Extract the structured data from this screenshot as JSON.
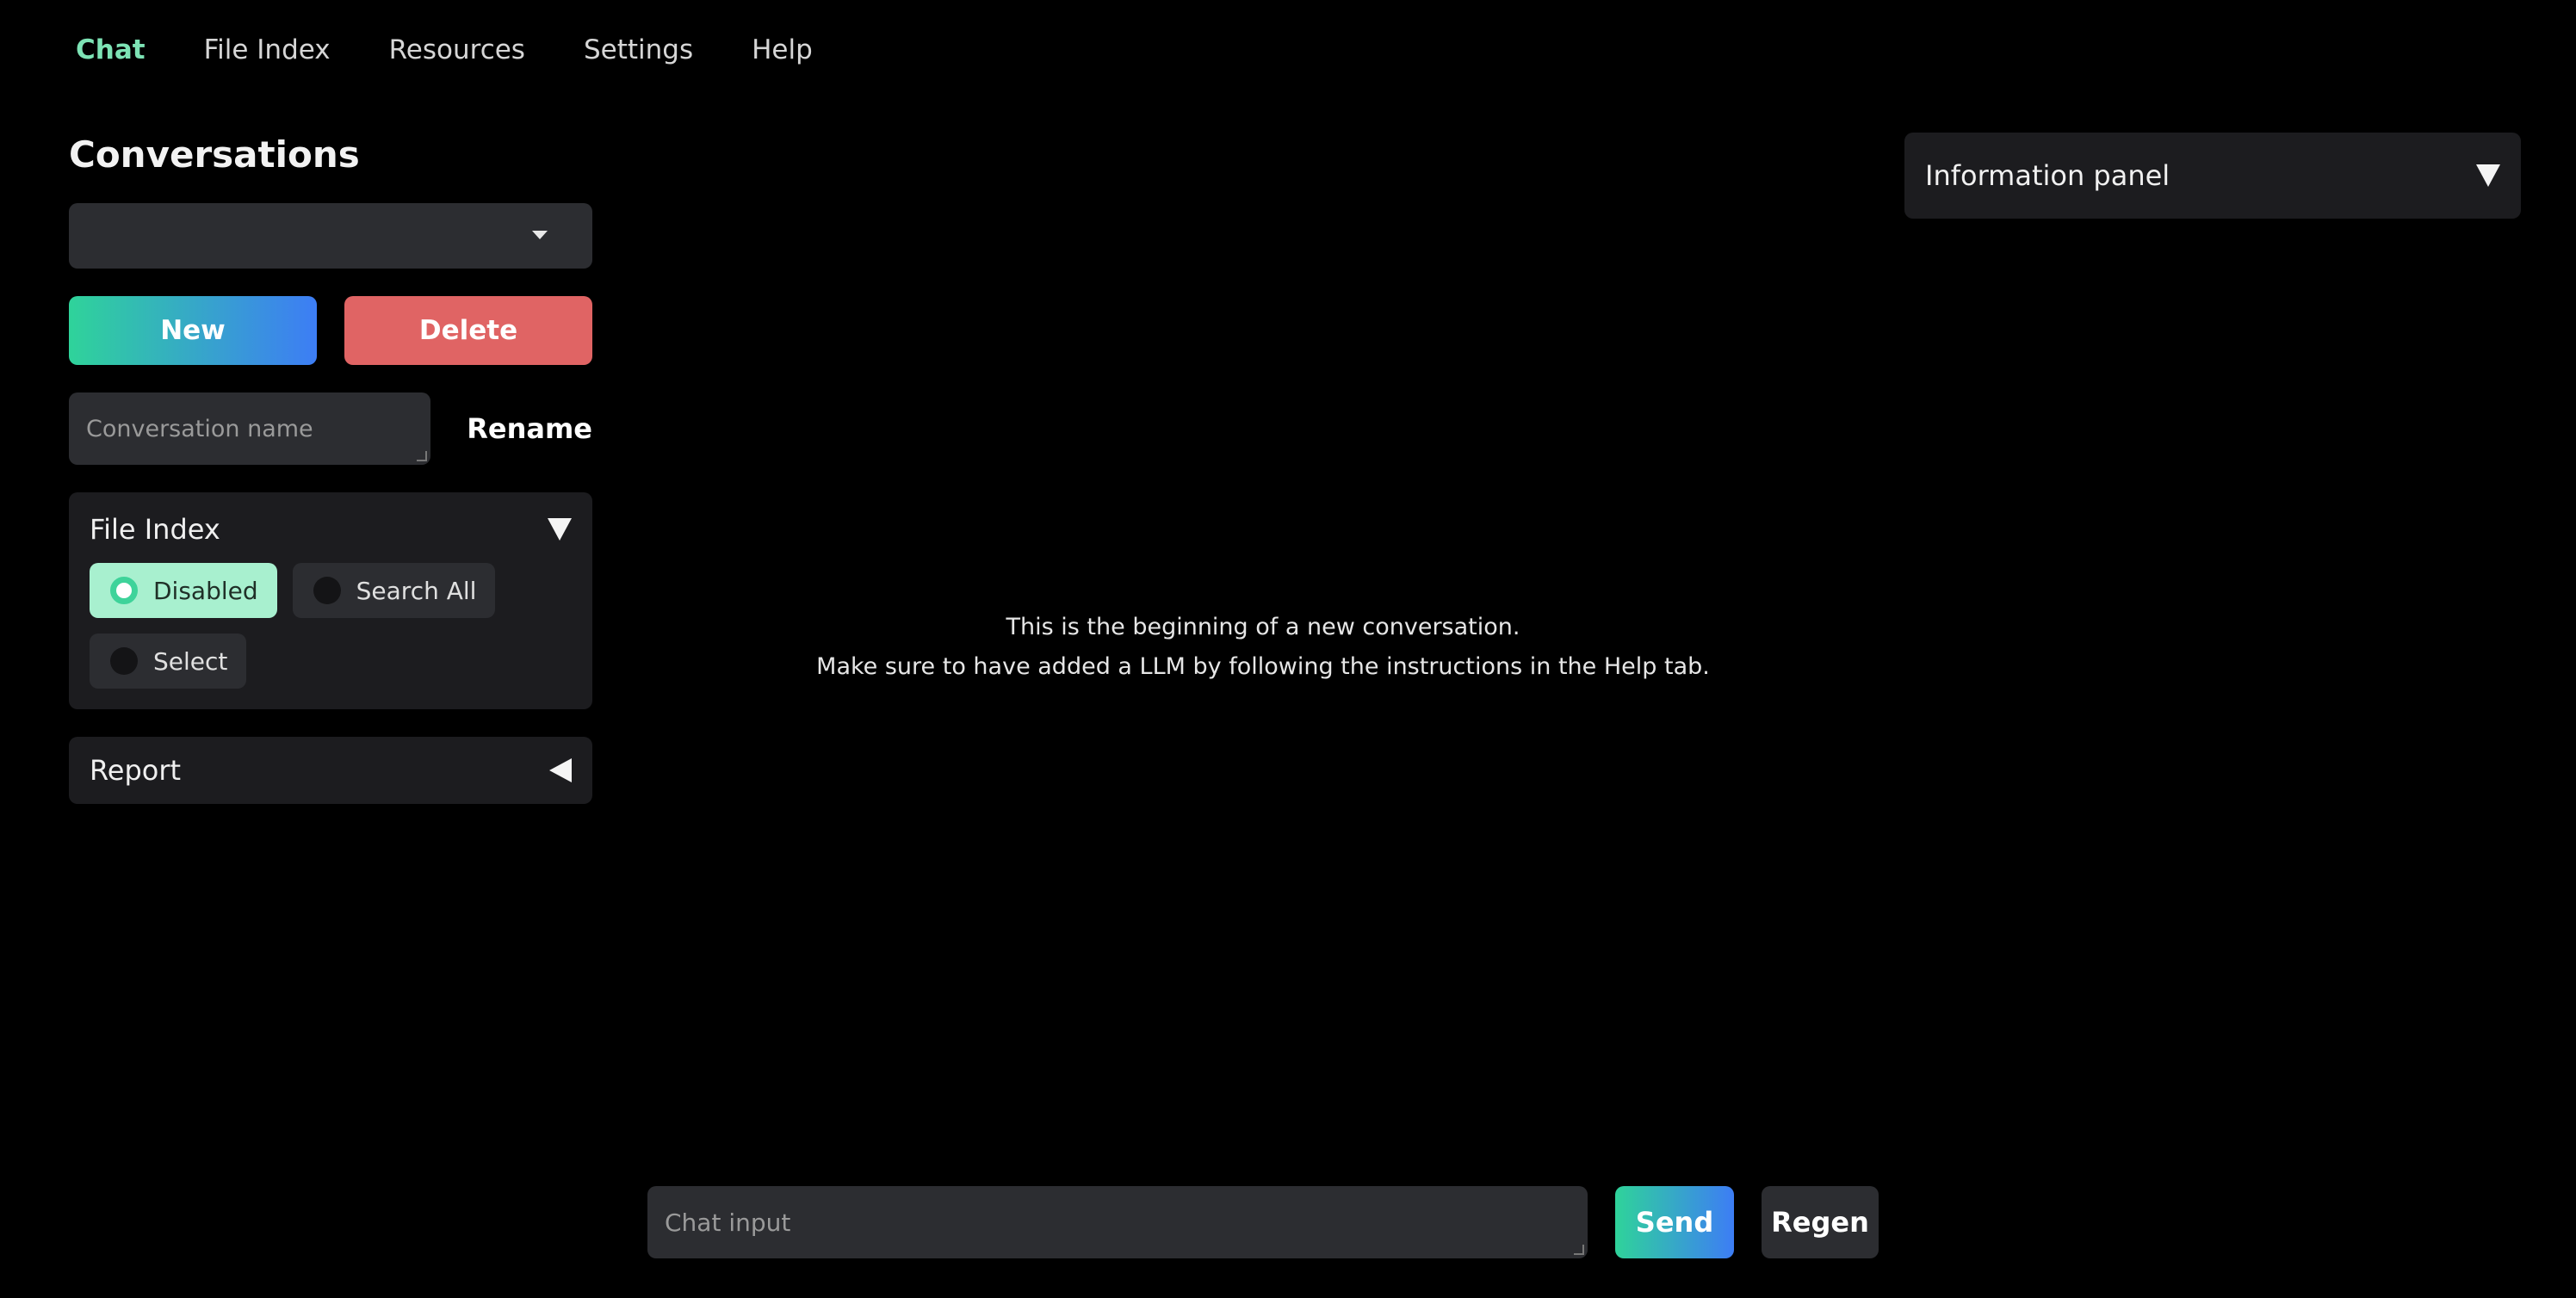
{
  "tabs": [
    {
      "label": "Chat",
      "active": true
    },
    {
      "label": "File Index",
      "active": false
    },
    {
      "label": "Resources",
      "active": false
    },
    {
      "label": "Settings",
      "active": false
    },
    {
      "label": "Help",
      "active": false
    }
  ],
  "conversations": {
    "title": "Conversations",
    "selected": "",
    "new_label": "New",
    "delete_label": "Delete",
    "name_placeholder": "Conversation name",
    "rename_label": "Rename"
  },
  "file_index": {
    "title": "File Index",
    "options": [
      "Disabled",
      "Search All",
      "Select"
    ],
    "selected": "Disabled"
  },
  "report": {
    "title": "Report"
  },
  "chat": {
    "message_line1": "This is the beginning of a new conversation.",
    "message_line2": "Make sure to have added a LLM by following the instructions in the Help tab.",
    "input_placeholder": "Chat input",
    "send_label": "Send",
    "regen_label": "Regen"
  },
  "info_panel": {
    "title": "Information panel"
  },
  "icons": {
    "dropdown": "chevron-down-icon",
    "collapse_open": "triangle-down-icon",
    "collapse_closed": "triangle-left-icon"
  },
  "colors": {
    "accent_green": "#7de3b5",
    "gradient_start": "#2fd39a",
    "gradient_end": "#3d7df5",
    "delete_red": "#e06464"
  }
}
